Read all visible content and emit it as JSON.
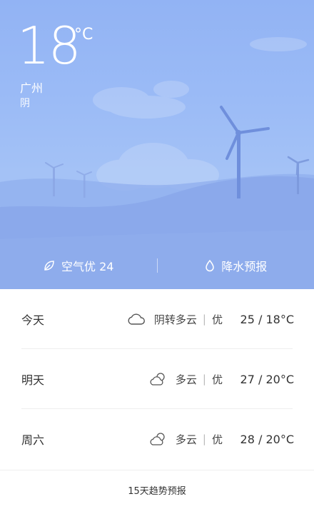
{
  "current": {
    "temperature": "18",
    "unit": "°C",
    "city": "广州",
    "condition": "阴"
  },
  "hero_bar": {
    "air_quality": "空气优 24",
    "precipitation": "降水预报"
  },
  "forecast": [
    {
      "day": "今天",
      "icon": "cloud-icon",
      "condition": "阴转多云",
      "aqi": "优",
      "range": "25 / 18°C"
    },
    {
      "day": "明天",
      "icon": "partly-cloudy-icon",
      "condition": "多云",
      "aqi": "优",
      "range": "27 / 20°C"
    },
    {
      "day": "周六",
      "icon": "partly-cloudy-icon",
      "condition": "多云",
      "aqi": "优",
      "range": "28 / 20°C"
    }
  ],
  "footer": {
    "label": "15天趋势预报"
  },
  "colors": {
    "sky": "#9bbbf6",
    "hills": "#8aa9ee",
    "text_dark": "#333333"
  }
}
